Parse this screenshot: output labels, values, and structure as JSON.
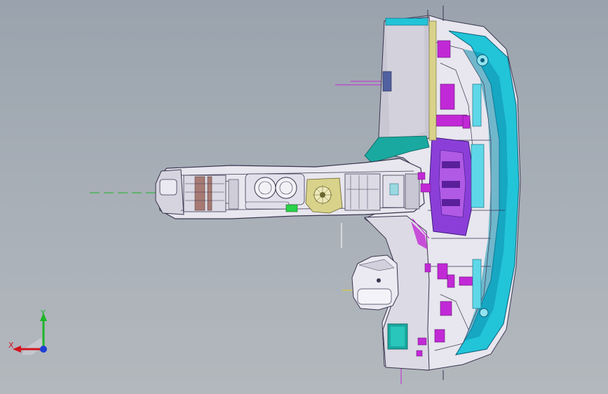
{
  "viewport": {
    "background_top": "#9aa3ad",
    "background_bottom": "#b3b8bd"
  },
  "triad": {
    "x_label": "X",
    "y_label": "Y",
    "x_color": "#d4141e",
    "y_color": "#1fb52a",
    "z_color": "#1f3fd4"
  },
  "model": {
    "colors": {
      "trim_white": "#e8e6ee",
      "panel_grey": "#c9c7d3",
      "edge_dark": "#3a3650",
      "cyan": "#22c4d8",
      "cyan_dark": "#0c8fb0",
      "magenta": "#c229d6",
      "purple": "#8b3fd8",
      "yellow_olive": "#d8d28a",
      "green": "#2ad24a",
      "teal": "#19a9a0"
    },
    "icons": [
      "cup-holder-icon",
      "shift-knob-icon",
      "dimension-line-icon"
    ]
  }
}
